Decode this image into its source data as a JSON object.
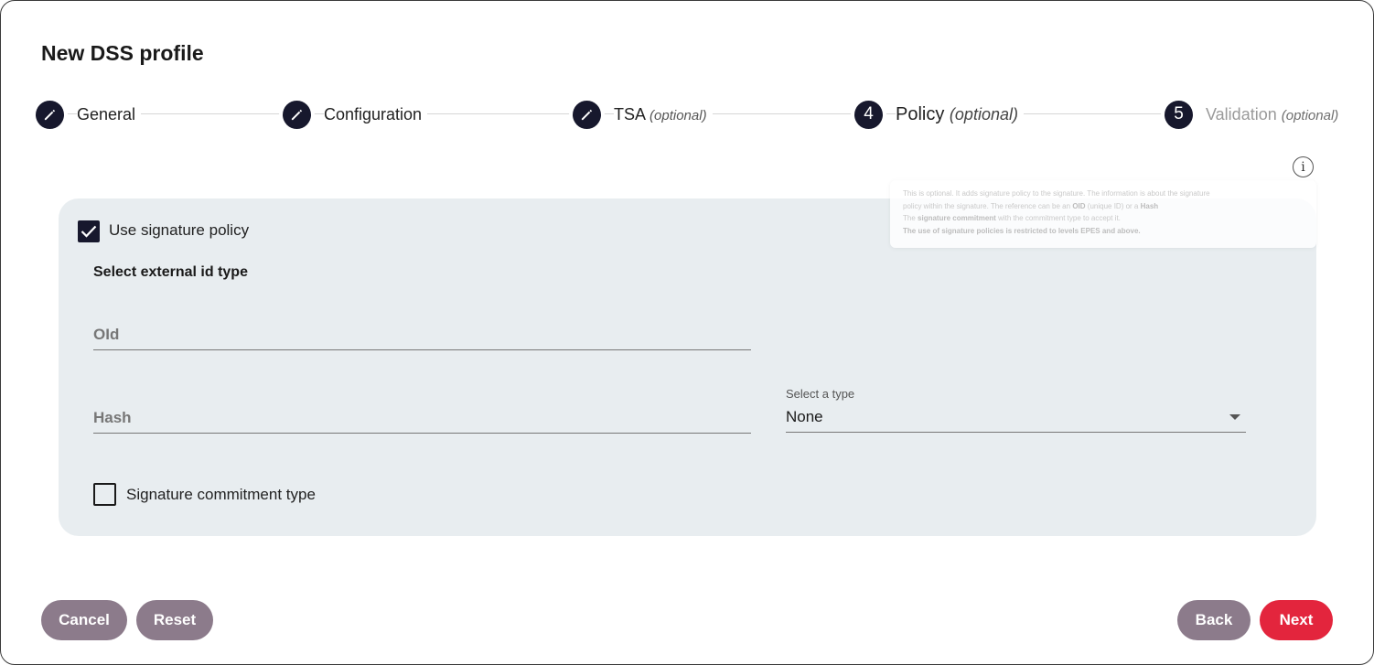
{
  "dialog": {
    "title": "New DSS profile"
  },
  "stepper": {
    "steps": [
      {
        "label": "General",
        "optional": "",
        "state": "completed",
        "icon": "pencil-icon"
      },
      {
        "label": "Configuration",
        "optional": "",
        "state": "completed",
        "icon": "pencil-icon"
      },
      {
        "label": "TSA",
        "optional": "(optional)",
        "state": "completed",
        "icon": "pencil-icon"
      },
      {
        "label": "Policy",
        "optional": "(optional)",
        "state": "active",
        "number": "4"
      },
      {
        "label": "Validation",
        "optional": "(optional)",
        "state": "upcoming",
        "number": "5"
      }
    ]
  },
  "info": {
    "icon": "info-icon",
    "glyph": "i",
    "tooltip": {
      "line1": "This is optional. It adds signature policy to the signature. The information is about the signature",
      "line2a": "policy within the signature. The reference can be an",
      "line2_oid": "OID",
      "line2b": "(unique ID) or a",
      "line2_hash": "Hash",
      "line3a": "The",
      "line3_commit": "signature commitment",
      "line3b": "with the commitment type to accept it.",
      "line4": "The use of signature policies is restricted to levels EPES and above."
    }
  },
  "policy": {
    "use_policy_label": "Use signature policy",
    "use_policy_checked": true,
    "external_id_title": "Select external id type",
    "oid_placeholder": "OId",
    "hash_placeholder": "Hash",
    "hash_type_label": "Select a type",
    "hash_type_value": "None",
    "commitment_label": "Signature commitment type",
    "commitment_checked": false
  },
  "actions": {
    "cancel": "Cancel",
    "reset": "Reset",
    "back": "Back",
    "next": "Next"
  },
  "colors": {
    "primary_dark": "#17182d",
    "button_grey": "#8c7b8b",
    "button_red": "#e3253d",
    "panel_bg": "#e8edf0"
  }
}
